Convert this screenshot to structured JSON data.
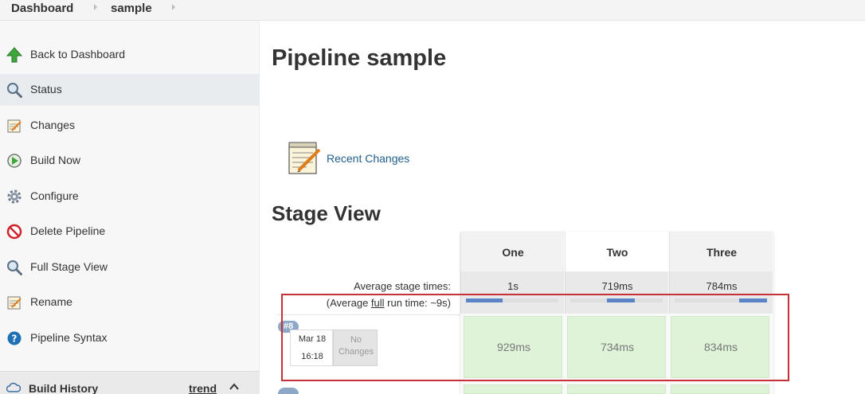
{
  "breadcrumb": {
    "items": [
      {
        "label": "Dashboard"
      },
      {
        "label": "sample"
      }
    ]
  },
  "sidebar": {
    "items": [
      {
        "label": "Back to Dashboard",
        "icon": "up-arrow-icon"
      },
      {
        "label": "Status",
        "icon": "magnifier-icon",
        "active": true
      },
      {
        "label": "Changes",
        "icon": "notepad-icon"
      },
      {
        "label": "Build Now",
        "icon": "build-clock-icon"
      },
      {
        "label": "Configure",
        "icon": "gear-icon"
      },
      {
        "label": "Delete Pipeline",
        "icon": "no-entry-icon"
      },
      {
        "label": "Full Stage View",
        "icon": "magnifier-icon"
      },
      {
        "label": "Rename",
        "icon": "notepad-icon"
      },
      {
        "label": "Pipeline Syntax",
        "icon": "help-icon"
      }
    ],
    "build_history": {
      "title": "Build History",
      "trend_label": "trend"
    }
  },
  "main": {
    "title": "Pipeline sample",
    "recent_changes_label": "Recent Changes",
    "stage_view_title": "Stage View"
  },
  "stage_view": {
    "stages": [
      "One",
      "Two",
      "Three"
    ],
    "avg_stage_times_label": "Average stage times:",
    "avg_run_time_prefix": "(Average ",
    "avg_run_time_link": "full",
    "avg_run_time_suffix": " run time: ~9s)",
    "avg_times": [
      "1s",
      "719ms",
      "784ms"
    ],
    "avg_bar_positions": [
      [
        0.0,
        0.4
      ],
      [
        0.4,
        0.7
      ],
      [
        0.7,
        1.0
      ]
    ],
    "builds": [
      {
        "number": "#8",
        "date": "Mar 18",
        "time": "16:18",
        "changes": "No Changes",
        "durations": [
          "929ms",
          "734ms",
          "834ms"
        ]
      }
    ]
  },
  "colors": {
    "stage_success": "#dff3d8",
    "highlight": "#c8303a",
    "link": "#1f5e8c",
    "bar": "#5b84c7"
  }
}
